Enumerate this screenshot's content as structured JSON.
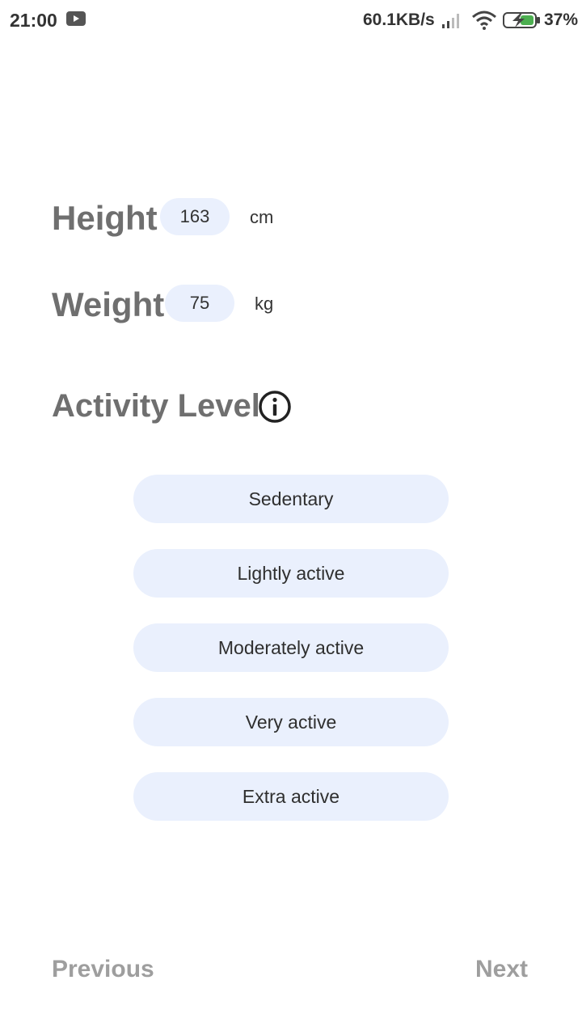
{
  "status_bar": {
    "time": "21:00",
    "network_speed": "60.1KB/s",
    "battery_percent": "37%",
    "icons": [
      "youtube-icon",
      "signal-icon",
      "wifi-icon",
      "battery-charging-icon"
    ]
  },
  "form": {
    "height": {
      "label": "Height",
      "value": "163",
      "unit": "cm"
    },
    "weight": {
      "label": "Weight",
      "value": "75",
      "unit": "kg"
    }
  },
  "activity": {
    "title": "Activity Level",
    "info_icon": "info-icon",
    "options": [
      "Sedentary",
      "Lightly active",
      "Moderately active",
      "Very active",
      "Extra active"
    ]
  },
  "navigation": {
    "previous_label": "Previous",
    "next_label": "Next"
  },
  "colors": {
    "pill_background": "#eaf0fd",
    "label_gray": "#6f6f6f",
    "nav_gray": "#9e9e9e"
  }
}
